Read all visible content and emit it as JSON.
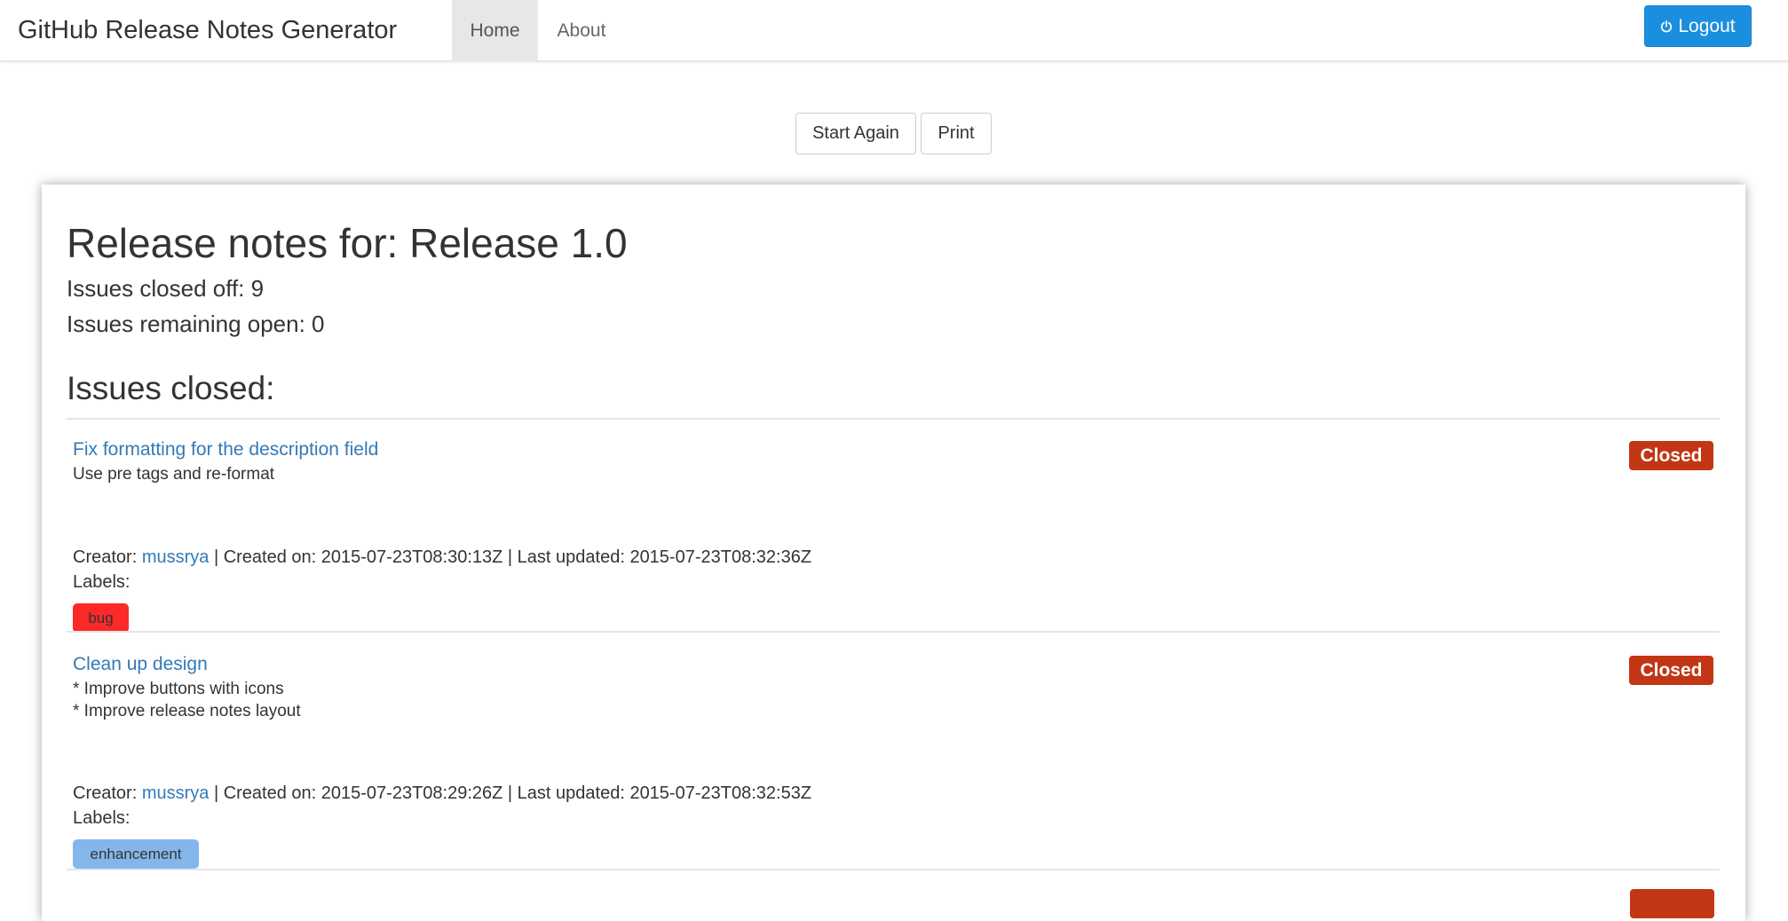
{
  "navbar": {
    "brand": "GitHub Release Notes Generator",
    "tabs": [
      {
        "label": "Home",
        "active": true
      },
      {
        "label": "About",
        "active": false
      }
    ],
    "logout_label": "Logout"
  },
  "actions": {
    "start_again": "Start Again",
    "print": "Print"
  },
  "release": {
    "title": "Release notes for: Release 1.0",
    "closed_text": "Issues closed off: 9",
    "open_text": "Issues remaining open: 0",
    "section_heading": "Issues closed:"
  },
  "issues": [
    {
      "title": "Fix formatting for the description field",
      "description": [
        "Use pre tags and re-format"
      ],
      "status": "Closed",
      "creator_label": "Creator:",
      "creator": "mussrya",
      "dates": "| Created on: 2015-07-23T08:30:13Z | Last updated: 2015-07-23T08:32:36Z",
      "labels_caption": "Labels:",
      "labels": [
        {
          "name": "bug",
          "color": "#fc2929"
        }
      ]
    },
    {
      "title": "Clean up design",
      "description": [
        "* Improve buttons with icons",
        "* Improve release notes layout"
      ],
      "status": "Closed",
      "creator_label": "Creator:",
      "creator": "mussrya",
      "dates": "| Created on: 2015-07-23T08:29:26Z | Last updated: 2015-07-23T08:32:53Z",
      "labels_caption": "Labels:",
      "labels": [
        {
          "name": "enhancement",
          "color": "#84b6eb"
        }
      ]
    }
  ],
  "colors": {
    "brand_blue": "#1a8fe0",
    "link": "#337ab7",
    "closed_badge": "#c23615"
  },
  "icons": {
    "logout": "power-icon"
  }
}
